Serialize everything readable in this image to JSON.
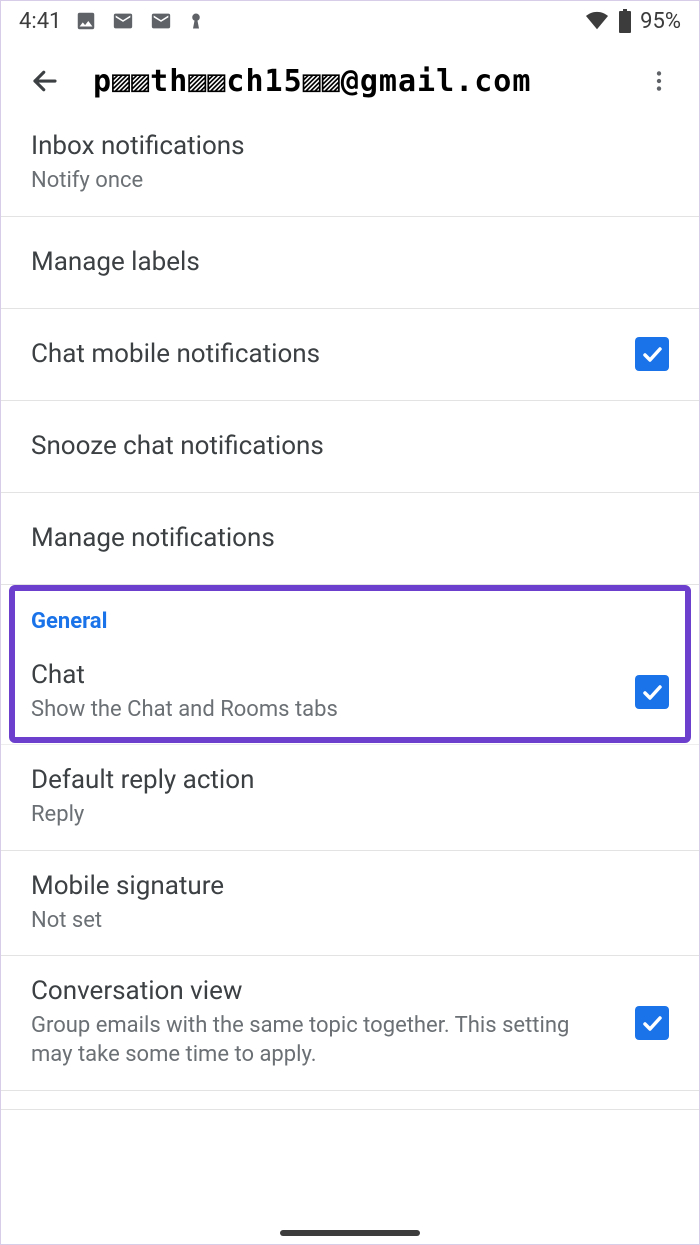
{
  "status": {
    "time": "4:41",
    "battery_pct": "95%"
  },
  "header": {
    "account_email": "p▨▨th▨▨ch15▨▨@gmail.com"
  },
  "rows": {
    "inbox_notifications": {
      "title": "Inbox notifications",
      "sub": "Notify once"
    },
    "manage_labels": {
      "title": "Manage labels"
    },
    "chat_mobile_notifications": {
      "title": "Chat mobile notifications",
      "checked": true
    },
    "snooze_chat_notifications": {
      "title": "Snooze chat notifications"
    },
    "manage_notifications": {
      "title": "Manage notifications"
    }
  },
  "section_general": {
    "header": "General",
    "chat": {
      "title": "Chat",
      "sub": "Show the Chat and Rooms tabs",
      "checked": true
    },
    "default_reply": {
      "title": "Default reply action",
      "sub": "Reply"
    },
    "mobile_signature": {
      "title": "Mobile signature",
      "sub": "Not set"
    },
    "conversation_view": {
      "title": "Conversation view",
      "sub": "Group emails with the same topic together. This setting may take some time to apply.",
      "checked": true
    }
  }
}
